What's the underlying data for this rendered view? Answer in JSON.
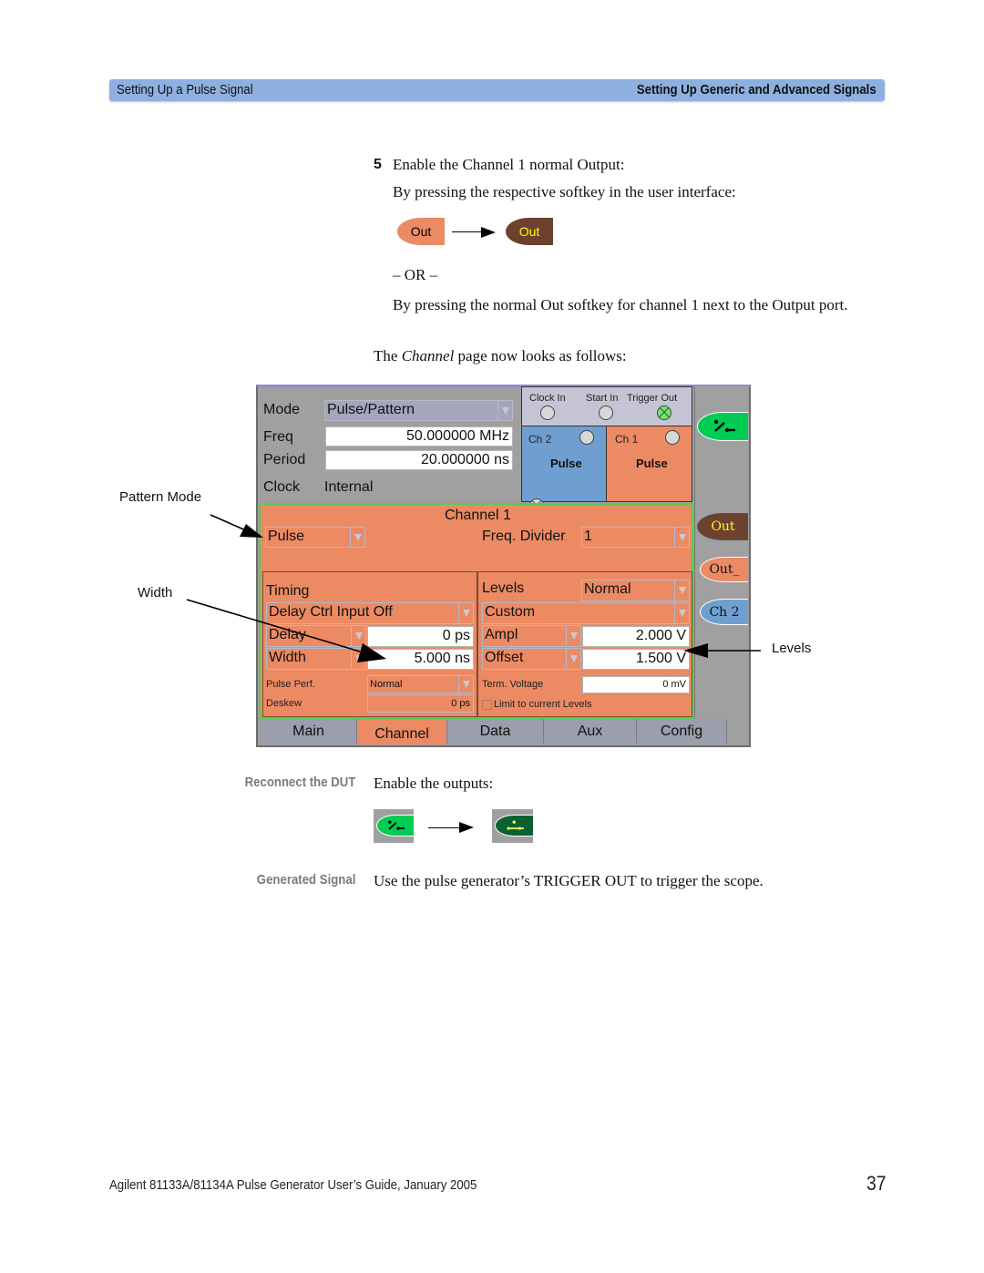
{
  "header": {
    "left_title": "Setting Up a Pulse Signal",
    "right_title": "Setting Up Generic and Advanced Signals",
    "band_color": "#8eb0e0"
  },
  "step": {
    "number": "5",
    "title": "Enable the Channel 1 normal Output:",
    "instruction_softkey": "By pressing the respective softkey in the user interface:",
    "softkey_before": {
      "label": "Out",
      "color": "#ec8a64",
      "text_color": "#000000"
    },
    "softkey_after": {
      "label": "Out",
      "color": "#6e4030",
      "text_color": "#ffff00"
    },
    "or_text": "– OR –",
    "instruction_port": "By pressing the normal Out softkey for channel 1 next to the Output port.",
    "channel_page_prefix": "The ",
    "channel_page_italic": "Channel",
    "channel_page_suffix": " page now looks as follows:"
  },
  "annotations": {
    "pattern_mode": "Pattern Mode",
    "width": "Width",
    "levels": "Levels"
  },
  "screen": {
    "top": {
      "mode_label": "Mode",
      "mode_value": "Pulse/Pattern",
      "freq_label": "Freq",
      "freq_value": "50.000000 MHz",
      "period_label": "Period",
      "period_value": "20.000000 ns",
      "clock_label": "Clock",
      "clock_value": "Internal"
    },
    "ports": {
      "clock_in": "Clock In",
      "start_in": "Start In",
      "trigger_out": "Trigger Out",
      "ch2_label": "Ch 2",
      "ch2_mode": "Pulse",
      "ch1_label": "Ch 1",
      "ch1_mode": "Pulse"
    },
    "channel": {
      "title": "Channel 1",
      "pattern_mode_value": "Pulse",
      "freq_divider_label": "Freq. Divider",
      "freq_divider_value": "1"
    },
    "timing": {
      "title": "Timing",
      "delay_ctrl": "Delay Ctrl Input Off",
      "delay_label": "Delay",
      "delay_value": "0 ps",
      "width_label": "Width",
      "width_value": "5.000 ns",
      "pulse_perf_label": "Pulse Perf.",
      "pulse_perf_value": "Normal",
      "deskew_label": "Deskew",
      "deskew_value": "0 ps"
    },
    "levels": {
      "title": "Levels",
      "mode_value": "Normal",
      "preset_value": "Custom",
      "ampl_label": "Ampl",
      "ampl_value": "2.000 V",
      "offset_label": "Offset",
      "offset_value": "1.500 V",
      "term_voltage_label": "Term. Voltage",
      "term_voltage_value": "0 mV",
      "limit_label": "Limit to current Levels",
      "limit_checked": false
    },
    "softkeys": {
      "out": "Out",
      "out_inverted": "Out_",
      "ch2": "Ch 2"
    },
    "tabs": [
      {
        "label": "Main",
        "active": false
      },
      {
        "label": "Channel",
        "active": true
      },
      {
        "label": "Data",
        "active": false
      },
      {
        "label": "Aux",
        "active": false
      },
      {
        "label": "Config",
        "active": false
      }
    ],
    "colors": {
      "channel1": "#ec8a64",
      "channel2": "#6f9fd0",
      "output_on": "#00cc55",
      "panel_gray": "#a0a0a0"
    }
  },
  "reconnect": {
    "side_label": "Reconnect the DUT",
    "text": "Enable the outputs:"
  },
  "generated": {
    "side_label": "Generated Signal",
    "text": "Use the pulse generator’s TRIGGER OUT to trigger the scope."
  },
  "footer": {
    "text": "Agilent 81133A/81134A Pulse Generator User’s Guide, January 2005",
    "page_number": "37"
  }
}
